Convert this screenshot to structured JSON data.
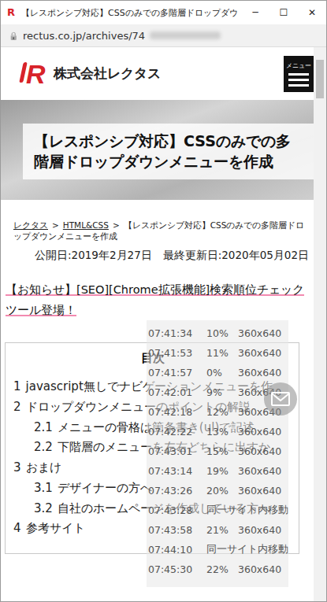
{
  "window": {
    "favicon": "R",
    "title": "【レスポンシブ対応】CSSのみでの多階層ドロップダウ",
    "controls": [
      "─",
      "☐",
      "✕"
    ]
  },
  "address_bar": {
    "lock": "🔒",
    "url": "rectus.co.jp/archives/74"
  },
  "header": {
    "logo_mark": "R",
    "company": "株式会社レクタス",
    "menu_label": "メニュー"
  },
  "article": {
    "title": "【レスポンシブ対応】CSSのみでの多階層ドロップダウンメニューを作成",
    "breadcrumb": {
      "separator": ">",
      "items": [
        {
          "text": "レクタス",
          "link": true
        },
        {
          "text": "HTML&CSS",
          "link": true
        },
        {
          "text": "【レスポンシブ対応】CSSのみでの多階層ドロップダウンメニューを作成",
          "link": false
        }
      ]
    },
    "published": "公開日:2019年2月27日",
    "updated": "最終更新日:2020年05月02日",
    "notice": "【お知らせ】[SEO][Chrome拡張機能]検索順位チェックツール登場！"
  },
  "toc": {
    "title": "目次",
    "items": [
      {
        "number": "1",
        "text": "javascript無しでナビゲーションメニューを作",
        "depth": 1
      },
      {
        "number": "2",
        "text": "ドロップダウンメニューのポイントの解説",
        "depth": 1
      },
      {
        "number": "2.1",
        "text": "メニューの骨格は箇条書き(ul)で記述",
        "depth": 2
      },
      {
        "number": "2.2",
        "text": "下階層のメニューを左右どちらに出すか",
        "depth": 2
      },
      {
        "number": "3",
        "text": "おまけ",
        "depth": 1
      },
      {
        "number": "3.1",
        "text": "デザイナーの方へ",
        "depth": 2
      },
      {
        "number": "3.2",
        "text": "自社のホームページを作成している方へ",
        "depth": 2
      },
      {
        "number": "4",
        "text": "参考サイト",
        "depth": 1
      }
    ]
  },
  "scroll_log": {
    "rows": [
      {
        "kind": "reading",
        "time": "07:41:34",
        "percent": "10%",
        "size": "360x640"
      },
      {
        "kind": "reading",
        "time": "07:41:53",
        "percent": "11%",
        "size": "360x640"
      },
      {
        "kind": "reading",
        "time": "07:41:57",
        "percent": "0%",
        "size": "360x640"
      },
      {
        "kind": "reading",
        "time": "07:42:01",
        "percent": "9%",
        "size": "360x640"
      },
      {
        "kind": "reading",
        "time": "07:42:18",
        "percent": "12%",
        "size": "360x640"
      },
      {
        "kind": "reading",
        "time": "07:42:22",
        "percent": "13%",
        "size": "360x640"
      },
      {
        "kind": "reading",
        "time": "07:43:01",
        "percent": "15%",
        "size": "360x640"
      },
      {
        "kind": "reading",
        "time": "07:43:14",
        "percent": "19%",
        "size": "360x640"
      },
      {
        "kind": "reading",
        "time": "07:43:26",
        "percent": "20%",
        "size": "360x640"
      },
      {
        "kind": "navigation",
        "time": "07:43:28",
        "text": "同一サイト内移動"
      },
      {
        "kind": "reading",
        "time": "07:43:58",
        "percent": "21%",
        "size": "360x640"
      },
      {
        "kind": "navigation",
        "time": "07:44:10",
        "text": "同一サイト内移動"
      },
      {
        "kind": "reading",
        "time": "07:45:30",
        "percent": "22%",
        "size": "360x640"
      }
    ]
  },
  "scrollbar": {
    "level": 0.07
  }
}
